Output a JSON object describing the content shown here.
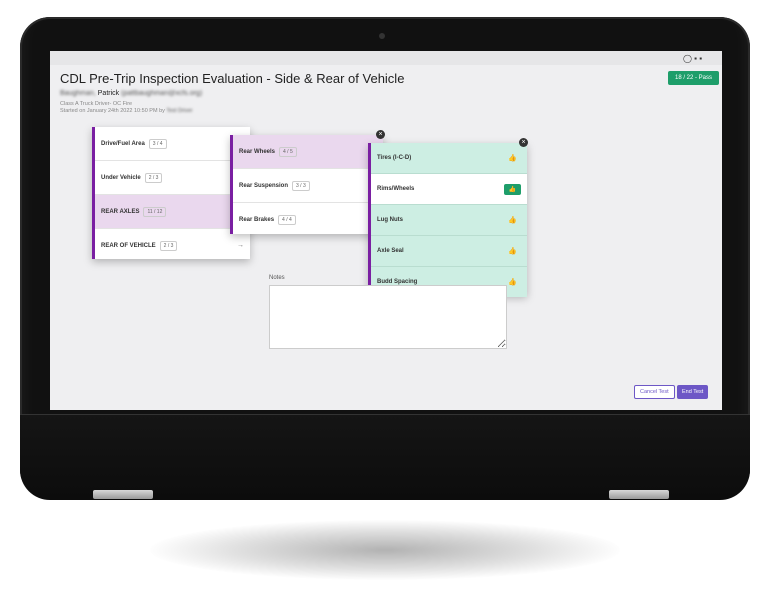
{
  "page": {
    "title": "CDL Pre-Trip Inspection Evaluation - Side & Rear of Vehicle",
    "score_badge": "18 / 22 - Pass",
    "candidate": {
      "name_blurred": "Baughman,",
      "name_visible": "Patrick",
      "email_blurred": "(pattbaughman@xcfs.org)"
    },
    "meta_line1": "Class A Truck Driver- OC Fire",
    "meta_line2": "Started on January 24th 2022 10:50 PM by",
    "meta_line2_blur": "Test Driver"
  },
  "categories": [
    {
      "label": "Drive/Fuel Area",
      "count": "3 / 4",
      "selected": false
    },
    {
      "label": "Under Vehicle",
      "count": "2 / 3",
      "selected": false
    },
    {
      "label": "REAR AXLES",
      "count": "11 / 12",
      "selected": true
    },
    {
      "label": "REAR OF VEHICLE",
      "count": "2 / 3",
      "selected": false
    }
  ],
  "subcategories": [
    {
      "label": "Rear Wheels",
      "count": "4 / 5",
      "selected": true
    },
    {
      "label": "Rear Suspension",
      "count": "3 / 3",
      "selected": false
    },
    {
      "label": "Rear Brakes",
      "count": "4 / 4",
      "selected": false
    }
  ],
  "items": [
    {
      "label": "Tires (I-C-D)"
    },
    {
      "label": "Rims/Wheels"
    },
    {
      "label": "Lug Nuts"
    },
    {
      "label": "Axle Seal"
    },
    {
      "label": "Budd Spacing"
    }
  ],
  "notes_label": "Notes",
  "buttons": {
    "cancel": "Cancel Test",
    "end": "End Test"
  },
  "icons": {
    "thumbs_up": "👍",
    "close": "×",
    "arrow": "→"
  },
  "colors": {
    "accent": "#7a1fa2",
    "pass": "#1e9e6a",
    "primary": "#6d57c6"
  }
}
